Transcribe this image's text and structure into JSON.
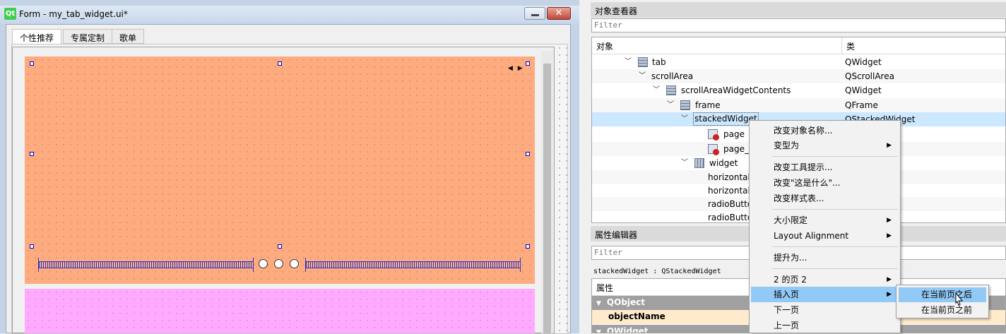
{
  "form_window": {
    "title": "Form - my_tab_widget.ui*",
    "logo": "Qt",
    "minimize_icon": "minimize-icon",
    "close_icon": "close-icon",
    "close_glyph": "✕",
    "tabs": [
      {
        "label": "个性推荐",
        "active": true
      },
      {
        "label": "专属定制",
        "active": false
      },
      {
        "label": "歌单",
        "active": false
      }
    ],
    "page_colors": {
      "top_page": "#ffab80",
      "bottom_page": "#ffaaff"
    },
    "carousel_arrows": "◀ ▶",
    "radio_count": 3
  },
  "object_inspector": {
    "title": "对象查看器",
    "filter_placeholder": "Filter",
    "col_object": "对象",
    "col_class": "类",
    "rows": [
      {
        "name": "tab",
        "cls": "QWidget",
        "icon": "layout-icon",
        "expanded": true
      },
      {
        "name": "scrollArea",
        "cls": "QScrollArea",
        "icon": "",
        "expanded": true
      },
      {
        "name": "scrollAreaWidgetContents",
        "cls": "QWidget",
        "icon": "layout-icon",
        "expanded": true
      },
      {
        "name": "frame",
        "cls": "QFrame",
        "icon": "layout-icon",
        "expanded": true
      },
      {
        "name": "stackedWidget",
        "cls": "QStackedWidget",
        "icon": "",
        "expanded": true,
        "selected": true
      },
      {
        "name": "page",
        "cls": "",
        "icon": "page-icon"
      },
      {
        "name": "page_",
        "cls": "",
        "icon": "page-icon"
      },
      {
        "name": "widget",
        "cls": "",
        "icon": "columns-icon",
        "expanded": true
      },
      {
        "name": "horizontal",
        "cls": "",
        "icon": ""
      },
      {
        "name": "horizontal",
        "cls": "",
        "icon": ""
      },
      {
        "name": "radioButto",
        "cls": "",
        "icon": ""
      },
      {
        "name": "radioButto",
        "cls": "",
        "icon": ""
      }
    ]
  },
  "property_editor": {
    "title": "属性编辑器",
    "filter_placeholder": "Filter",
    "selected_label": "stackedWidget : QStackedWidget",
    "col_property": "属性",
    "groups": [
      "QObject",
      "QWidget"
    ],
    "object_name_label": "objectName"
  },
  "context_menu": {
    "items": [
      {
        "label": "改变对象名称...",
        "submenu": false
      },
      {
        "label": "变型为",
        "submenu": true
      },
      {
        "label": "改变工具提示...",
        "submenu": false
      },
      {
        "label": "改变\"这是什么\"...",
        "submenu": false
      },
      {
        "label": "改变样式表...",
        "submenu": false
      },
      {
        "label": "大小限定",
        "submenu": true
      },
      {
        "label": "Layout Alignment",
        "submenu": true
      },
      {
        "label": "提升为...",
        "submenu": false
      },
      {
        "label": "2 的页 2",
        "submenu": true
      },
      {
        "label": "插入页",
        "submenu": true,
        "highlighted": true
      },
      {
        "label": "下一页",
        "submenu": false
      },
      {
        "label": "上一页",
        "submenu": false
      }
    ],
    "submenu_arrow": "▶"
  },
  "insert_page_submenu": {
    "items": [
      {
        "label": "在当前页之后",
        "highlighted": true
      },
      {
        "label": "在当前页之前",
        "highlighted": false
      }
    ]
  }
}
